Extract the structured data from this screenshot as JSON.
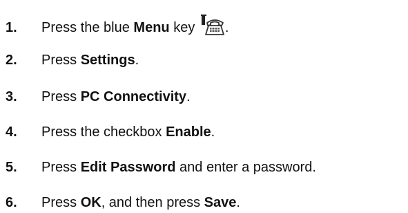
{
  "steps": [
    {
      "number": "1.",
      "parts": [
        {
          "text": "Press the blue ",
          "bold": false
        },
        {
          "text": "Menu",
          "bold": true
        },
        {
          "text": " key",
          "bold": false
        }
      ],
      "icon": "menu-key-phone-icon",
      "trailing": "."
    },
    {
      "number": "2.",
      "parts": [
        {
          "text": "Press ",
          "bold": false
        },
        {
          "text": "Settings",
          "bold": true
        },
        {
          "text": ".",
          "bold": false
        }
      ]
    },
    {
      "number": "3.",
      "parts": [
        {
          "text": "Press ",
          "bold": false
        },
        {
          "text": "PC Connectivity",
          "bold": true
        },
        {
          "text": ".",
          "bold": false
        }
      ]
    },
    {
      "number": "4.",
      "parts": [
        {
          "text": "Press the checkbox ",
          "bold": false
        },
        {
          "text": "Enable",
          "bold": true
        },
        {
          "text": ".",
          "bold": false
        }
      ]
    },
    {
      "number": "5.",
      "parts": [
        {
          "text": "Press ",
          "bold": false
        },
        {
          "text": "Edit Password",
          "bold": true
        },
        {
          "text": " and enter a password.",
          "bold": false
        }
      ]
    },
    {
      "number": "6.",
      "parts": [
        {
          "text": "Press ",
          "bold": false
        },
        {
          "text": "OK",
          "bold": true
        },
        {
          "text": ", and then press ",
          "bold": false
        },
        {
          "text": "Save",
          "bold": true
        },
        {
          "text": ".",
          "bold": false
        }
      ]
    }
  ]
}
